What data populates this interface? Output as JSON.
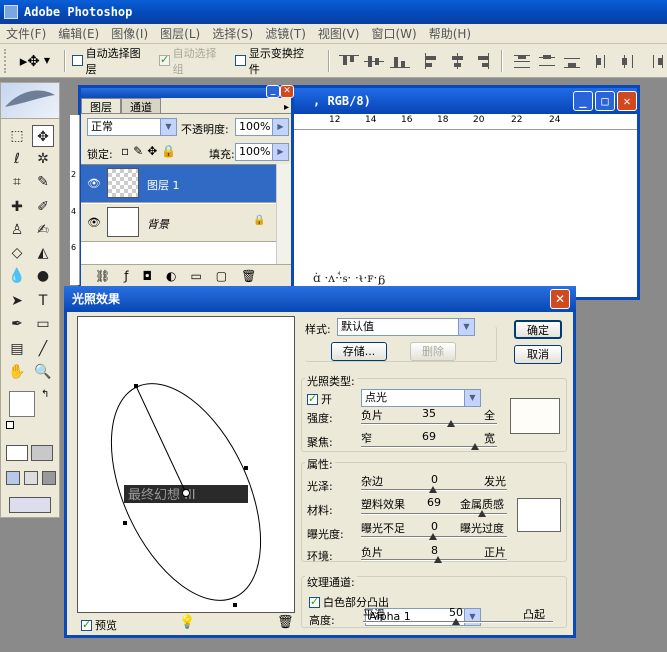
{
  "app": {
    "title": "Adobe Photoshop"
  },
  "menu": [
    "文件(F)",
    "编辑(E)",
    "图像(I)",
    "图层(L)",
    "选择(S)",
    "滤镜(T)",
    "视图(V)",
    "窗口(W)",
    "帮助(H)"
  ],
  "options": {
    "auto_select_layer": "自动选择图层",
    "auto_select_group": "自动选择组",
    "show_transform": "显示变换控件"
  },
  "document": {
    "title": ", RGB/8)",
    "ruler_labels": [
      "12",
      "14",
      "16",
      "18",
      "20",
      "22",
      "24"
    ]
  },
  "layers_panel": {
    "tab_layers": "图层",
    "tab_channels": "通道",
    "blend_mode": "正常",
    "opacity_label": "不透明度:",
    "opacity_value": "100%",
    "lock_label": "锁定:",
    "fill_label": "填充:",
    "fill_value": "100%",
    "layers": [
      {
        "name": "图层 1",
        "selected": true
      },
      {
        "name": "背景",
        "selected": false
      }
    ],
    "ruler_left": [
      "2",
      "4",
      "6",
      "8"
    ]
  },
  "dialog": {
    "title": "光照效果",
    "style_label": "样式:",
    "style_value": "默认值",
    "save_button": "存储...",
    "delete_button": "删除",
    "ok_button": "确定",
    "cancel_button": "取消",
    "light_type_label": "光照类型:",
    "light_type_value": "点光",
    "on_label": "开",
    "intensity": {
      "label": "强度:",
      "left": "负片",
      "right": "全",
      "value": "35"
    },
    "focus": {
      "label": "聚焦:",
      "left": "窄",
      "right": "宽",
      "value": "69"
    },
    "properties_label": "属性:",
    "gloss": {
      "label": "光泽:",
      "left": "杂边",
      "right": "发光",
      "value": "0"
    },
    "material": {
      "label": "材料:",
      "left": "塑料效果",
      "right": "金属质感",
      "value": "69"
    },
    "exposure": {
      "label": "曝光度:",
      "left": "曝光不足",
      "right": "曝光过度",
      "value": "0"
    },
    "ambience": {
      "label": "环境:",
      "left": "负片",
      "right": "正片",
      "value": "8"
    },
    "texture_label": "纹理通道:",
    "texture_value": "Alpha 1",
    "white_high_label": "白色部分凸出",
    "height": {
      "label": "高度:",
      "left": "平滑",
      "right": "凸起",
      "value": "50"
    },
    "preview_label": "预览",
    "preview_text": "最终幻想 III"
  },
  "colors": {
    "title_blue": "#0a49b8",
    "selection": "#316ac5",
    "dialog_bg": "#ece9d8",
    "close_red": "#d3491f"
  }
}
